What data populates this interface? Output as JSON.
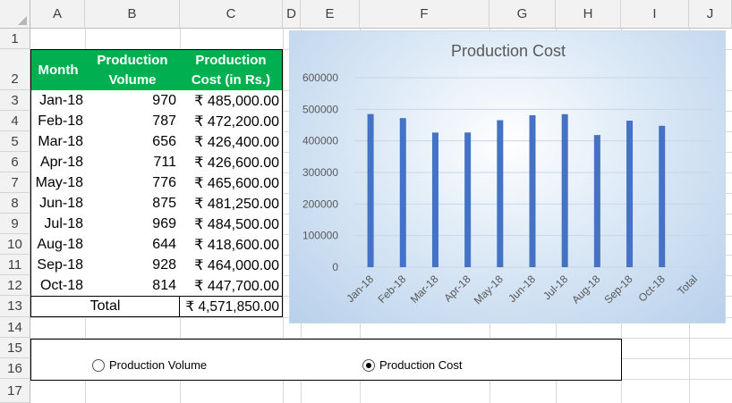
{
  "columns": [
    "A",
    "B",
    "C",
    "D",
    "E",
    "F",
    "G",
    "H",
    "I",
    "J"
  ],
  "rows": [
    "1",
    "2",
    "3",
    "4",
    "5",
    "6",
    "7",
    "8",
    "9",
    "10",
    "11",
    "12",
    "13",
    "14",
    "15",
    "16",
    "17"
  ],
  "table": {
    "header": {
      "month": "Month",
      "volume": "Production Volume",
      "cost": "Production Cost (in Rs.)"
    },
    "rows": [
      {
        "month": "Jan-18",
        "volume": "970",
        "cost": "₹ 485,000.00"
      },
      {
        "month": "Feb-18",
        "volume": "787",
        "cost": "₹ 472,200.00"
      },
      {
        "month": "Mar-18",
        "volume": "656",
        "cost": "₹ 426,400.00"
      },
      {
        "month": "Apr-18",
        "volume": "711",
        "cost": "₹ 426,600.00"
      },
      {
        "month": "May-18",
        "volume": "776",
        "cost": "₹ 465,600.00"
      },
      {
        "month": "Jun-18",
        "volume": "875",
        "cost": "₹ 481,250.00"
      },
      {
        "month": "Jul-18",
        "volume": "969",
        "cost": "₹ 484,500.00"
      },
      {
        "month": "Aug-18",
        "volume": "644",
        "cost": "₹ 418,600.00"
      },
      {
        "month": "Sep-18",
        "volume": "928",
        "cost": "₹ 464,000.00"
      },
      {
        "month": "Oct-18",
        "volume": "814",
        "cost": "₹ 447,700.00"
      }
    ],
    "total_label": "Total",
    "total_value": "₹ 4,571,850.00"
  },
  "chart_data": {
    "type": "bar",
    "title": "Production Cost",
    "categories": [
      "Jan-18",
      "Feb-18",
      "Mar-18",
      "Apr-18",
      "May-18",
      "Jun-18",
      "Jul-18",
      "Aug-18",
      "Sep-18",
      "Oct-18",
      "Total"
    ],
    "values": [
      485000,
      472200,
      426400,
      426600,
      465600,
      481250,
      484500,
      418600,
      464000,
      447700,
      null
    ],
    "ylim": [
      0,
      600000
    ],
    "yticks": [
      "0",
      "100000",
      "200000",
      "300000",
      "400000",
      "500000",
      "600000"
    ],
    "bar_color": "#4472c4",
    "grid": true
  },
  "options": {
    "volume_label": "Production Volume",
    "cost_label": "Production Cost",
    "selected": "cost"
  }
}
